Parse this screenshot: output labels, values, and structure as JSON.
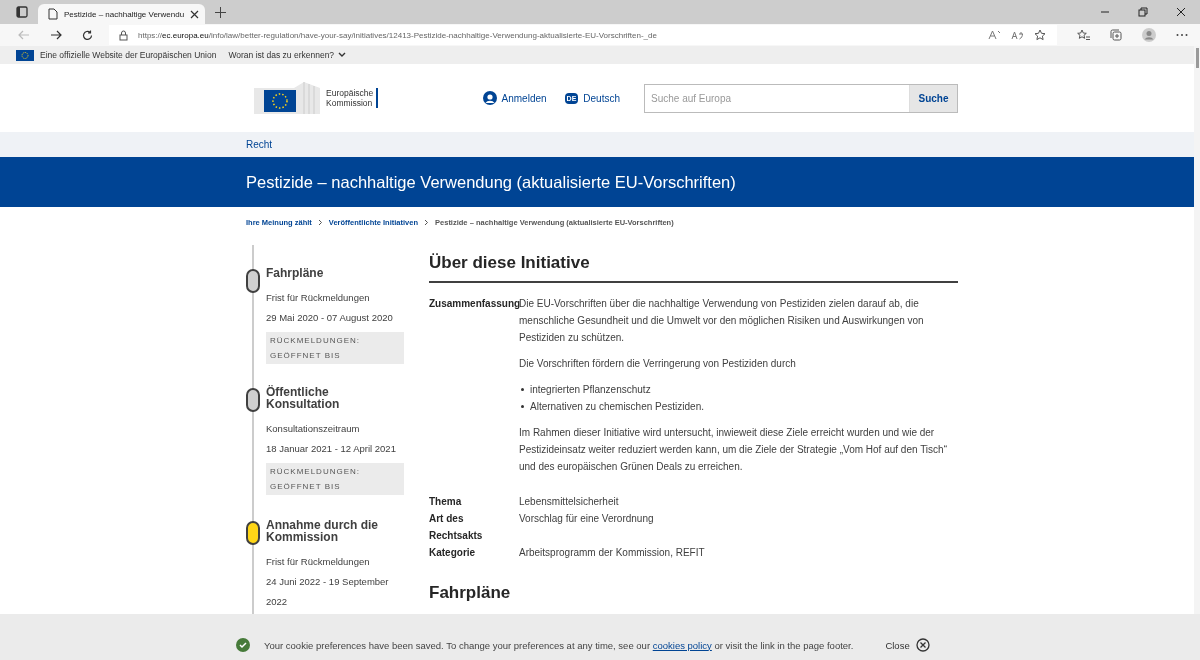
{
  "browser": {
    "tab_title": "Pestizide – nachhaltige Verwendu",
    "url_scheme": "https://",
    "url_host": "ec.europa.eu",
    "url_path": "/info/law/better-regulation/have-your-say/initiatives/12413-Pestizide-nachhaltige-Verwendung-aktualisierte-EU-Vorschriften-_de"
  },
  "eu_bar": {
    "text": "Eine offizielle Website der Europäischen Union",
    "link": "Woran ist das zu erkennen?"
  },
  "header": {
    "logo_lines": [
      "Europäische",
      "Kommission"
    ],
    "login": "Anmelden",
    "language_code": "DE",
    "language": "Deutsch",
    "search": {
      "placeholder": "Suche auf Europa",
      "button": "Suche"
    }
  },
  "section": "Recht",
  "page_title": "Pestizide – nachhaltige Verwendung (aktualisierte EU-Vorschriften)",
  "breadcrumb": [
    {
      "label": "Ihre Meinung zählt",
      "link": true
    },
    {
      "label": "Veröffentlichte Initiativen",
      "link": true
    },
    {
      "label": "Pestizide – nachhaltige Verwendung (aktualisierte EU-Vorschriften)",
      "link": false
    }
  ],
  "timeline": [
    {
      "title": "Fahrpläne",
      "label": "Frist für Rückmeldungen",
      "dates": "29 Mai 2020 - 07 August 2020",
      "badge": "RÜCKMELDUNGEN: GEÖFFNET BIS",
      "active": false
    },
    {
      "title": "Öffentliche Konsultation",
      "label": "Konsultationszeitraum",
      "dates": "18 Januar 2021 - 12 April 2021",
      "badge": "RÜCKMELDUNGEN: GEÖFFNET BIS",
      "active": false
    },
    {
      "title": "Annahme durch die Kommission",
      "label": "Frist für Rückmeldungen",
      "dates": "24 Juni 2022 - 19 September 2022",
      "active": true
    }
  ],
  "about": {
    "heading": "Über diese Initiative",
    "summary": {
      "label": "Zusammenfassung",
      "paragraphs": [
        "Die EU-Vorschriften über die nachhaltige Verwendung von Pestiziden zielen darauf ab, die menschliche Gesundheit und die Umwelt vor den möglichen Risiken und Auswirkungen von Pestiziden zu schützen.",
        "Die Vorschriften fördern die Verringerung von Pestiziden durch"
      ],
      "bullets": [
        "integrierten Pflanzenschutz",
        "Alternativen zu chemischen Pestiziden."
      ],
      "closing": "Im Rahmen dieser Initiative wird untersucht, inwieweit diese Ziele erreicht wurden und wie der Pestizideinsatz weiter reduziert werden kann, um die Ziele der Strategie „Vom Hof auf den Tisch“ und des europäischen Grünen Deals zu erreichen."
    },
    "details": [
      {
        "label": "Thema",
        "value": "Lebensmittelsicherheit"
      },
      {
        "label": "Art des Rechtsakts",
        "value": "Vorschlag für eine Verordnung"
      },
      {
        "label": "Kategorie",
        "value": "Arbeitsprogramm der Kommission, REFIT"
      }
    ]
  },
  "next_heading": "Fahrpläne",
  "cookie": {
    "before": "Your cookie preferences have been saved. To change your preferences at any time, see our",
    "link": "cookies policy",
    "after": "or visit the link in the page footer.",
    "close": "Close"
  }
}
